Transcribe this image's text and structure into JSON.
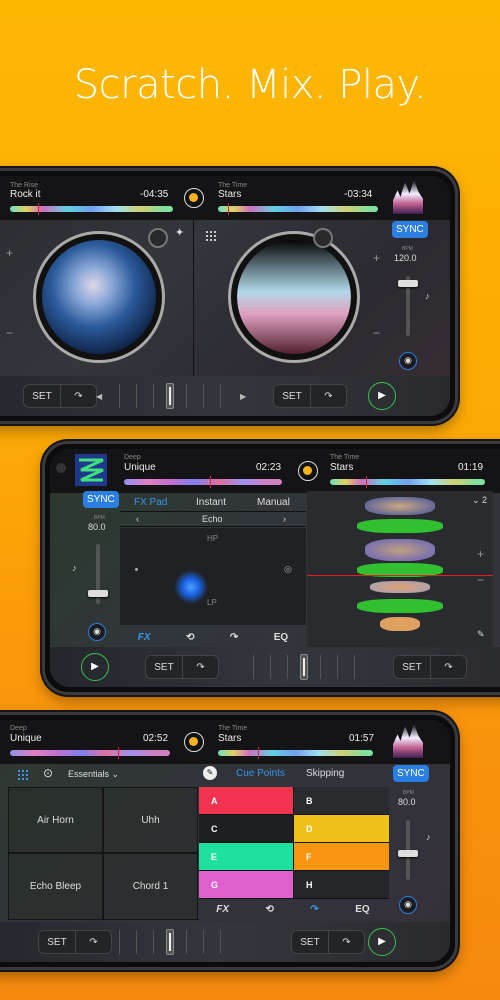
{
  "headline": "Scratch. Mix. Play.",
  "colors": {
    "accent_blue": "#2b7fe0",
    "play_green": "#3cc04c",
    "playhead_red": "#e02020",
    "center_dot": "#f6b21c"
  },
  "phone1": {
    "deck_left": {
      "artist": "The Rise",
      "title": "Rock it",
      "time": "-04:35"
    },
    "deck_right": {
      "artist": "The Time",
      "title": "Stars",
      "time": "-03:34"
    },
    "sync_label": "SYNC",
    "bpm_label": "BPM",
    "bpm": "120.0",
    "set_label": "SET",
    "plus": "+",
    "minus": "−"
  },
  "phone2": {
    "deck_left": {
      "artist": "Deep",
      "title": "Unique",
      "time": "02:23"
    },
    "deck_right": {
      "artist": "The Time",
      "title": "Stars",
      "time": "01:19"
    },
    "sync_label": "SYNC",
    "bpm_label": "BPM",
    "bpm": "80.0",
    "tabs": [
      "FX Pad",
      "Instant",
      "Manual"
    ],
    "effect": "Echo",
    "pad_top": "HP",
    "pad_bottom": "LP",
    "fx_bar": [
      "FX",
      "loop-icon",
      "jump-icon",
      "EQ"
    ],
    "zoom_level": "2",
    "set_label": "SET",
    "plus": "+",
    "minus": "−"
  },
  "phone3": {
    "deck_left": {
      "artist": "Deep",
      "title": "Unique",
      "time": "02:52"
    },
    "deck_right": {
      "artist": "The Time",
      "title": "Stars",
      "time": "01:57"
    },
    "sampler_bank": "Essentials",
    "samples": [
      "Air Horn",
      "Uhh",
      "Echo Bleep",
      "Chord 1"
    ],
    "tabs": [
      "Cue Points",
      "Skipping"
    ],
    "cue_pads": [
      {
        "label": "A",
        "color": "#f0334f"
      },
      {
        "label": "B",
        "color": "#2a2b2f"
      },
      {
        "label": "C",
        "color": "#1e1f22"
      },
      {
        "label": "D",
        "color": "#f0c01a"
      },
      {
        "label": "E",
        "color": "#20e0a0"
      },
      {
        "label": "F",
        "color": "#f59510"
      },
      {
        "label": "G",
        "color": "#e060d0"
      },
      {
        "label": "H",
        "color": "#25262a"
      }
    ],
    "fx_bar": [
      "FX",
      "loop-icon",
      "jump-icon",
      "EQ"
    ],
    "sync_label": "SYNC",
    "bpm_label": "BPM",
    "bpm": "80.0",
    "set_label": "SET"
  }
}
